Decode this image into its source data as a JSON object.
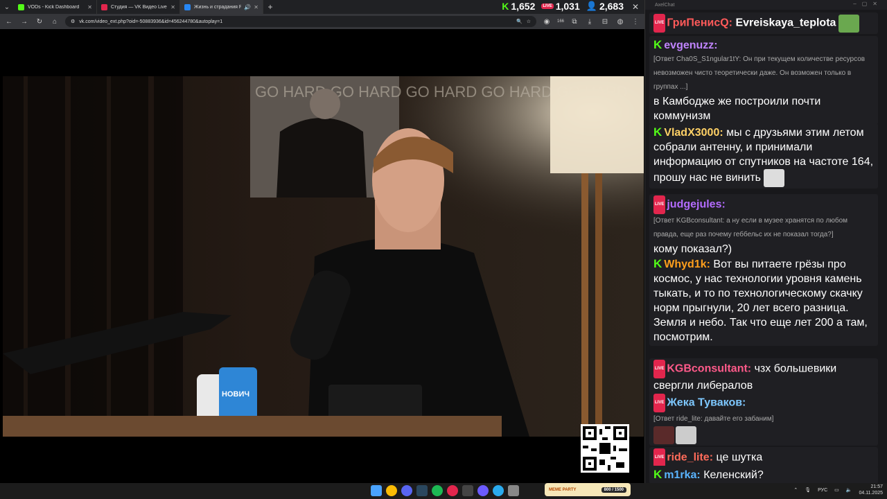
{
  "tabs": [
    {
      "title": "VODs - Kick Dashboard",
      "fav": "#53fc18"
    },
    {
      "title": "Студия — VK Видео Live",
      "fav": "#e2264d"
    },
    {
      "title": "Жизнь и страдания Рома...",
      "fav": "#2787f5"
    }
  ],
  "stats": {
    "kick": "1,652",
    "vk": "1,031",
    "viewers": "2,683",
    "vk_badge": "LIVE"
  },
  "url": "vk.com/video_ext.php?oid=-50883936&id=456244780&autoplay=1",
  "ext_badge": "166",
  "video": {
    "mug_text": "НОВИЧ",
    "poster_text": "GO HARD GO HARD GO HARD GO HARD GO HARD"
  },
  "chat": {
    "title": "AxelChat",
    "live_badge": "LIVE",
    "kick_badge": "K",
    "messages": [
      {
        "platform": "vk",
        "nick": "ГриПенисQ:",
        "nick_color": "#ff5a5a",
        "text": "Evreiskaya_teplota",
        "bold_text": true
      },
      {
        "platform": "kick",
        "nick": "evgenuzz:",
        "nick_color": "#c084fc",
        "reply": "[Ответ Cha0S_S1ngular1tY: Он при текущем количестве ресурсов невозможен чисто теоретически даже. Он возможен только в группах ...]",
        "text": "в Камбодже же построили почти коммунизм"
      },
      {
        "platform": "kick",
        "nick": "VladX3000:",
        "nick_color": "#ffd166",
        "text": "мы с друзьями этим летом собрали антенну, и принимали информацию от спутников на частоте 164, прошу нас не винить"
      },
      {
        "platform": "vk",
        "nick": "judgejules:",
        "nick_color": "#b36bff",
        "reply": "[Ответ KGBconsultant: а ну если в музее хранятся по любом правда, еще раз почему геббельс их не показал тогда?]",
        "text": "кому показал?)"
      },
      {
        "platform": "kick",
        "nick": "Whyd1k:",
        "nick_color": "#ff9f1c",
        "text": "Вот вы питаете грёзы про космос, у нас технологии уровня камень тыкать, и то по технологическому скачку норм прыгнули, 20 лет всего разница. Земля и небо. Так что еще лет 200 а там, посмотрим."
      },
      {
        "platform": "vk",
        "nick": "KGBconsultant:",
        "nick_color": "#ff5a8a",
        "text": "чзх большевики свергли либералов"
      },
      {
        "platform": "vk",
        "nick": "Жека Туваков:",
        "nick_color": "#7ec8ff",
        "reply": "[Ответ ride_lite: давайте его забаним]",
        "text": ""
      },
      {
        "platform": "vk",
        "nick": "ride_lite:",
        "nick_color": "#ff6b5a",
        "text": "це шутка"
      },
      {
        "platform": "kick",
        "nick": "m1rka:",
        "nick_color": "#5ab4ff",
        "text": "Келенский?"
      }
    ]
  },
  "taskbar": {
    "widget": "MEME PARTY",
    "widget_progress": "800 / 1500",
    "lang": "РУС",
    "time": "21:57",
    "date": "04.11.2025"
  }
}
